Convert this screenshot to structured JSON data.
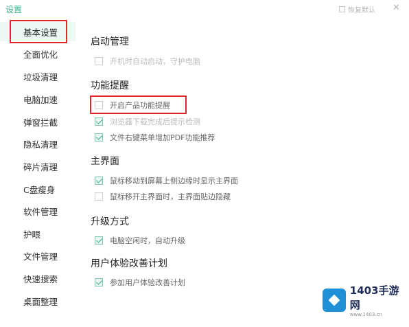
{
  "window": {
    "title": "设置",
    "restore_label": "恢复默认",
    "close_glyph": "✕"
  },
  "sidebar": {
    "items": [
      {
        "label": "基本设置",
        "active": true
      },
      {
        "label": "全面优化"
      },
      {
        "label": "垃圾清理"
      },
      {
        "label": "电脑加速"
      },
      {
        "label": "弹窗拦截"
      },
      {
        "label": "隐私清理"
      },
      {
        "label": "碎片清理"
      },
      {
        "label": "C盘瘦身"
      },
      {
        "label": "软件管理"
      },
      {
        "label": "护眼"
      },
      {
        "label": "文件管理"
      },
      {
        "label": "快速搜索"
      },
      {
        "label": "桌面整理"
      }
    ]
  },
  "sections": {
    "startup": {
      "title": "启动管理",
      "options": [
        {
          "label": "开机时自动启动，守护电脑",
          "checked": false
        }
      ]
    },
    "reminders": {
      "title": "功能提醒",
      "options": [
        {
          "label": "开启产品功能提醒",
          "checked": false
        },
        {
          "label": "浏览器下载完成后提示检测",
          "checked": true
        },
        {
          "label": "文件右键菜单增加PDF功能推荐",
          "checked": true
        }
      ]
    },
    "main_ui": {
      "title": "主界面",
      "options": [
        {
          "label": "鼠标移动到屏幕上侧边缘时显示主界面",
          "checked": true
        },
        {
          "label": "鼠标移开主界面时，主界面贴边隐藏",
          "checked": false
        }
      ]
    },
    "upgrade": {
      "title": "升级方式",
      "options": [
        {
          "label": "电脑空闲时，自动升级",
          "checked": true
        }
      ]
    },
    "experience": {
      "title": "用户体验改善计划",
      "options": [
        {
          "label": "参加用户体验改善计划",
          "checked": true
        }
      ]
    }
  },
  "watermark": {
    "brand": "1403手游网",
    "url": "www.1403.cn"
  },
  "colors": {
    "accent": "#3bb08f",
    "highlight": "#e0262b",
    "logo_blue": "#1f8fd6"
  }
}
